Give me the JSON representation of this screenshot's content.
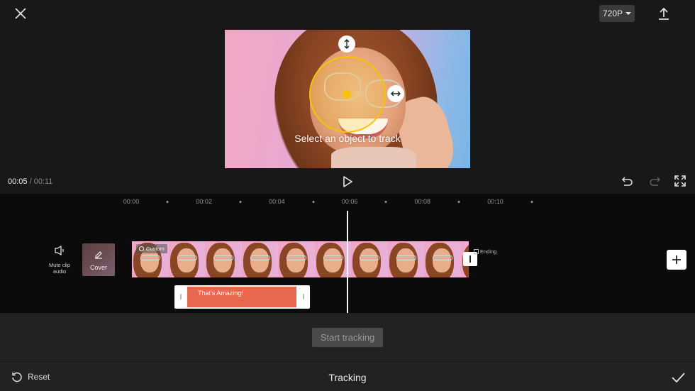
{
  "topbar": {
    "close_icon": "close-icon",
    "resolution": "720P",
    "export_icon": "upload-icon"
  },
  "preview": {
    "hint": "Select an object to track",
    "tracker_color": "#f6c400"
  },
  "playback": {
    "current_time": "00:05",
    "separator": " / ",
    "total_time": "00:11",
    "play_icon": "play-icon",
    "undo_icon": "undo-icon",
    "redo_icon": "redo-icon",
    "fullscreen_icon": "fullscreen-icon"
  },
  "timeline": {
    "ruler": [
      "00:00",
      "00:02",
      "00:04",
      "00:06",
      "00:08",
      "00:10"
    ],
    "mute_label_line1": "Mute clip",
    "mute_label_line2": "audio",
    "cover_label": "Cover",
    "custom_tag": "Custom",
    "ending_label": "Ending",
    "text_clip_label": "That's Amazing!",
    "text_clip_color": "#e8674f",
    "frame_count": 10
  },
  "actions": {
    "start_tracking": "Start tracking"
  },
  "bottombar": {
    "reset": "Reset",
    "title": "Tracking",
    "confirm_icon": "check-icon"
  }
}
